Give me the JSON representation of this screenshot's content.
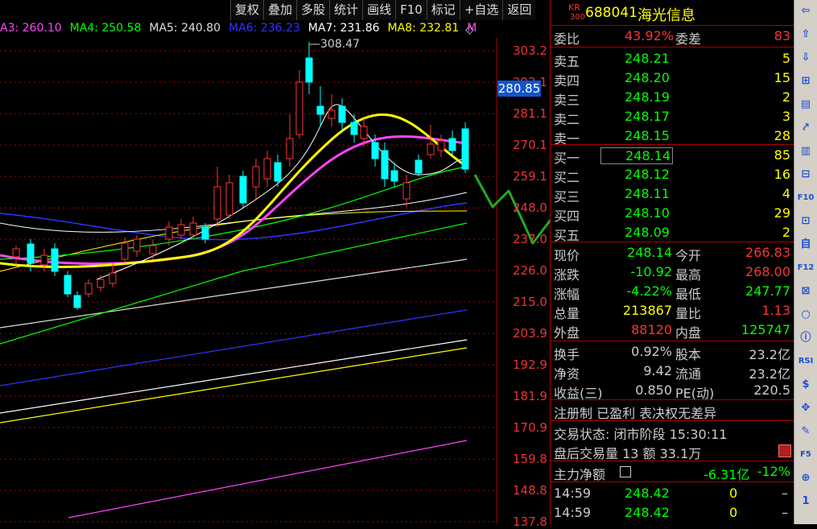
{
  "toolbar": {
    "items": [
      "复权",
      "叠加",
      "多股",
      "统计",
      "画线",
      "F10",
      "标记",
      "+自选",
      "返回"
    ]
  },
  "ma_legend": [
    {
      "label": "A3: 260.10",
      "color": "#ff44ff"
    },
    {
      "label": "MA4: 250.58",
      "color": "#00ff00"
    },
    {
      "label": "MA5: 240.80",
      "color": "#dddddd"
    },
    {
      "label": "MA6: 236.23",
      "color": "#3333ff"
    },
    {
      "label": "MA7: 231.86",
      "color": "#ffffff"
    },
    {
      "label": "MA8: 232.81",
      "color": "#ffff00"
    },
    {
      "label": "M",
      "color": "#ff44ff"
    }
  ],
  "chart": {
    "y_ticks": [
      "303.2",
      "292.1",
      "281.1",
      "270.1",
      "259.1",
      "248.0",
      "237.0",
      "226.0",
      "215.0",
      "203.9",
      "192.9",
      "181.9",
      "170.9",
      "159.8",
      "148.8",
      "137.8"
    ],
    "y_tick_values": [
      303.2,
      292.1,
      281.1,
      270.1,
      259.1,
      248.0,
      237.0,
      226.0,
      215.0,
      203.9,
      192.9,
      181.9,
      170.9,
      159.8,
      148.8,
      137.8
    ],
    "high_label": "308.47",
    "current_price_box": "280.85"
  },
  "stock": {
    "code_prefix": "KR",
    "index_tag": "300",
    "code": "688041",
    "name": "海光信息"
  },
  "weibi": {
    "label1": "委比",
    "value1": "43.92%",
    "label2": "委差",
    "value2": "83"
  },
  "asks": [
    {
      "label": "卖五",
      "price": "248.21",
      "vol": "5"
    },
    {
      "label": "卖四",
      "price": "248.20",
      "vol": "15"
    },
    {
      "label": "卖三",
      "price": "248.19",
      "vol": "2"
    },
    {
      "label": "卖二",
      "price": "248.17",
      "vol": "3"
    },
    {
      "label": "卖一",
      "price": "248.15",
      "vol": "28"
    }
  ],
  "bids": [
    {
      "label": "买一",
      "price": "248.14",
      "vol": "85"
    },
    {
      "label": "买二",
      "price": "248.12",
      "vol": "16"
    },
    {
      "label": "买三",
      "price": "248.11",
      "vol": "4"
    },
    {
      "label": "买四",
      "price": "248.10",
      "vol": "29"
    },
    {
      "label": "买五",
      "price": "248.09",
      "vol": "2"
    }
  ],
  "quote": [
    {
      "l1": "现价",
      "v1": "248.14",
      "c1": "#00ff00",
      "l2": "今开",
      "v2": "266.83",
      "c2": "#ff3333"
    },
    {
      "l1": "涨跌",
      "v1": "-10.92",
      "c1": "#00ff00",
      "l2": "最高",
      "v2": "268.00",
      "c2": "#ff3333"
    },
    {
      "l1": "涨幅",
      "v1": "-4.22%",
      "c1": "#00ff00",
      "l2": "最低",
      "v2": "247.77",
      "c2": "#00ff00"
    },
    {
      "l1": "总量",
      "v1": "213867",
      "c1": "#ffff00",
      "l2": "量比",
      "v2": "1.13",
      "c2": "#ff3333"
    },
    {
      "l1": "外盘",
      "v1": "88120",
      "c1": "#ff3333",
      "l2": "内盘",
      "v2": "125747",
      "c2": "#00ff00"
    }
  ],
  "fundamentals": [
    {
      "l1": "换手",
      "v1": "0.92%",
      "l2": "股本",
      "v2": "23.2亿"
    },
    {
      "l1": "净资",
      "v1": "9.42",
      "l2": "流通",
      "v2": "23.2亿"
    },
    {
      "l1": "收益(三)",
      "v1": "0.850",
      "l2": "PE(动)",
      "v2": "220.5"
    }
  ],
  "tags": "注册制 已盈利 表决权无差异",
  "trade_status": "交易状态: 闭市阶段 15:30:11",
  "after_hours": "盘后交易量 13 额 33.1万",
  "main_flow": {
    "label": "主力净额",
    "value": "-6.31亿",
    "pct": "-12%"
  },
  "ticks": [
    {
      "time": "14:59",
      "price": "248.42",
      "vol": "0",
      "flag": "–"
    },
    {
      "time": "14:59",
      "price": "248.42",
      "vol": "0",
      "flag": "–"
    }
  ],
  "sidebar": {
    "items": [
      "⇦",
      "⇧",
      "⇩",
      "⊞",
      "▤",
      "⤤",
      "▥",
      "⊟",
      "F10",
      "⊡",
      "自",
      "F12",
      "⊠",
      "○",
      "ⓘ",
      "RSI",
      "$",
      "✥",
      "✎",
      "F5",
      "⊕",
      "1"
    ]
  }
}
